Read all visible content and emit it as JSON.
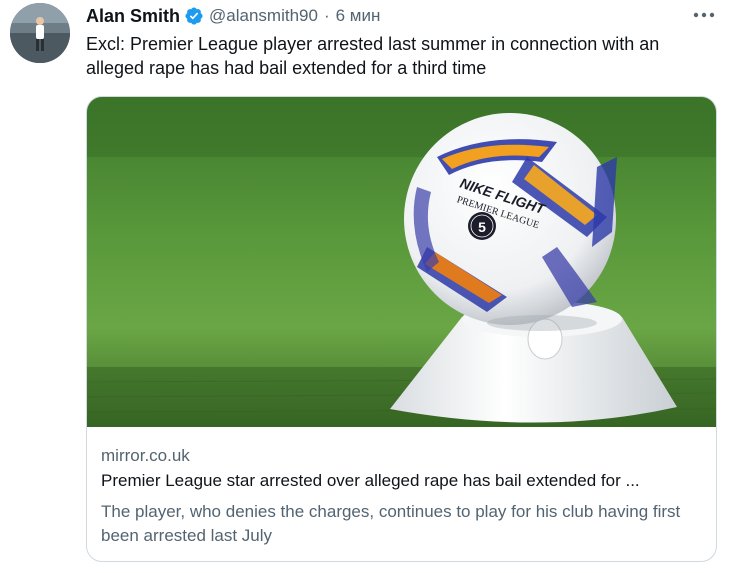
{
  "author": {
    "name": "Alan Smith",
    "handle": "@alansmith90",
    "separator": "·",
    "time": "6 мин",
    "verified": true,
    "avatar_icon": "avatar"
  },
  "tweet": {
    "text": "Excl: Premier League player arrested last summer in connection with an alleged rape has had bail extended for a third time"
  },
  "card": {
    "domain": "mirror.co.uk",
    "title": "Premier League star arrested over alleged rape has bail extended for ...",
    "description": "The player, who denies the charges, continues to play for his club having first been arrested last July",
    "image_icon": "football-on-cone-image",
    "ball_lettering": [
      "NIKE FLIGHT",
      "PREMIER LEAGUE",
      "5"
    ]
  },
  "icons": {
    "verified": "verified-badge-icon",
    "more": "more-options-icon"
  },
  "colors": {
    "verified": "#1d9bf0",
    "secondary_text": "#536471",
    "primary_text": "#0f1419",
    "border": "#cfd9de"
  }
}
